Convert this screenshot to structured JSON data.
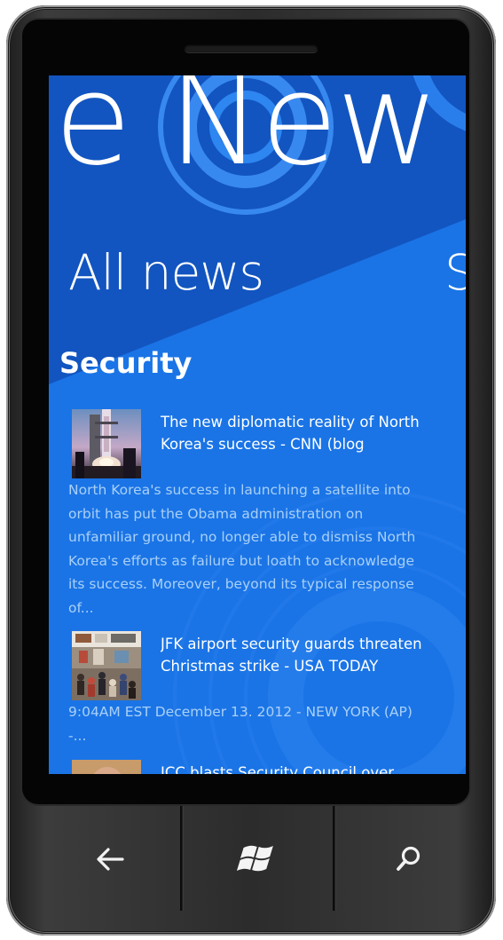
{
  "app": {
    "hub_title": "e New",
    "pivot_current": "All news",
    "pivot_next": "S"
  },
  "section": {
    "heading": "Security"
  },
  "articles": [
    {
      "title": "The new diplomatic reality of North Korea's success - CNN (blog",
      "summary": "North Korea's success in launching a satellite into orbit has put the Obama administration on unfamiliar ground, no longer able to dismiss North Korea's efforts as failure but loath to acknowledge its success. Moreover, beyond its typical response of..."
    },
    {
      "title": "JFK airport security guards threaten Christmas strike - USA TODAY",
      "summary": "9:04AM EST December 13. 2012 - NEW YORK (AP) -..."
    },
    {
      "title": "ICC blasts Security Council over"
    }
  ],
  "hardware_keys": {
    "back": "back-arrow-icon",
    "start": "windows-logo-icon",
    "search": "search-icon"
  },
  "colors": {
    "screen_blue": "#1a74e6",
    "panel_blue": "#1255c0",
    "summary_text": "#a9d0f7",
    "phone_body": "#2e2e2e"
  }
}
